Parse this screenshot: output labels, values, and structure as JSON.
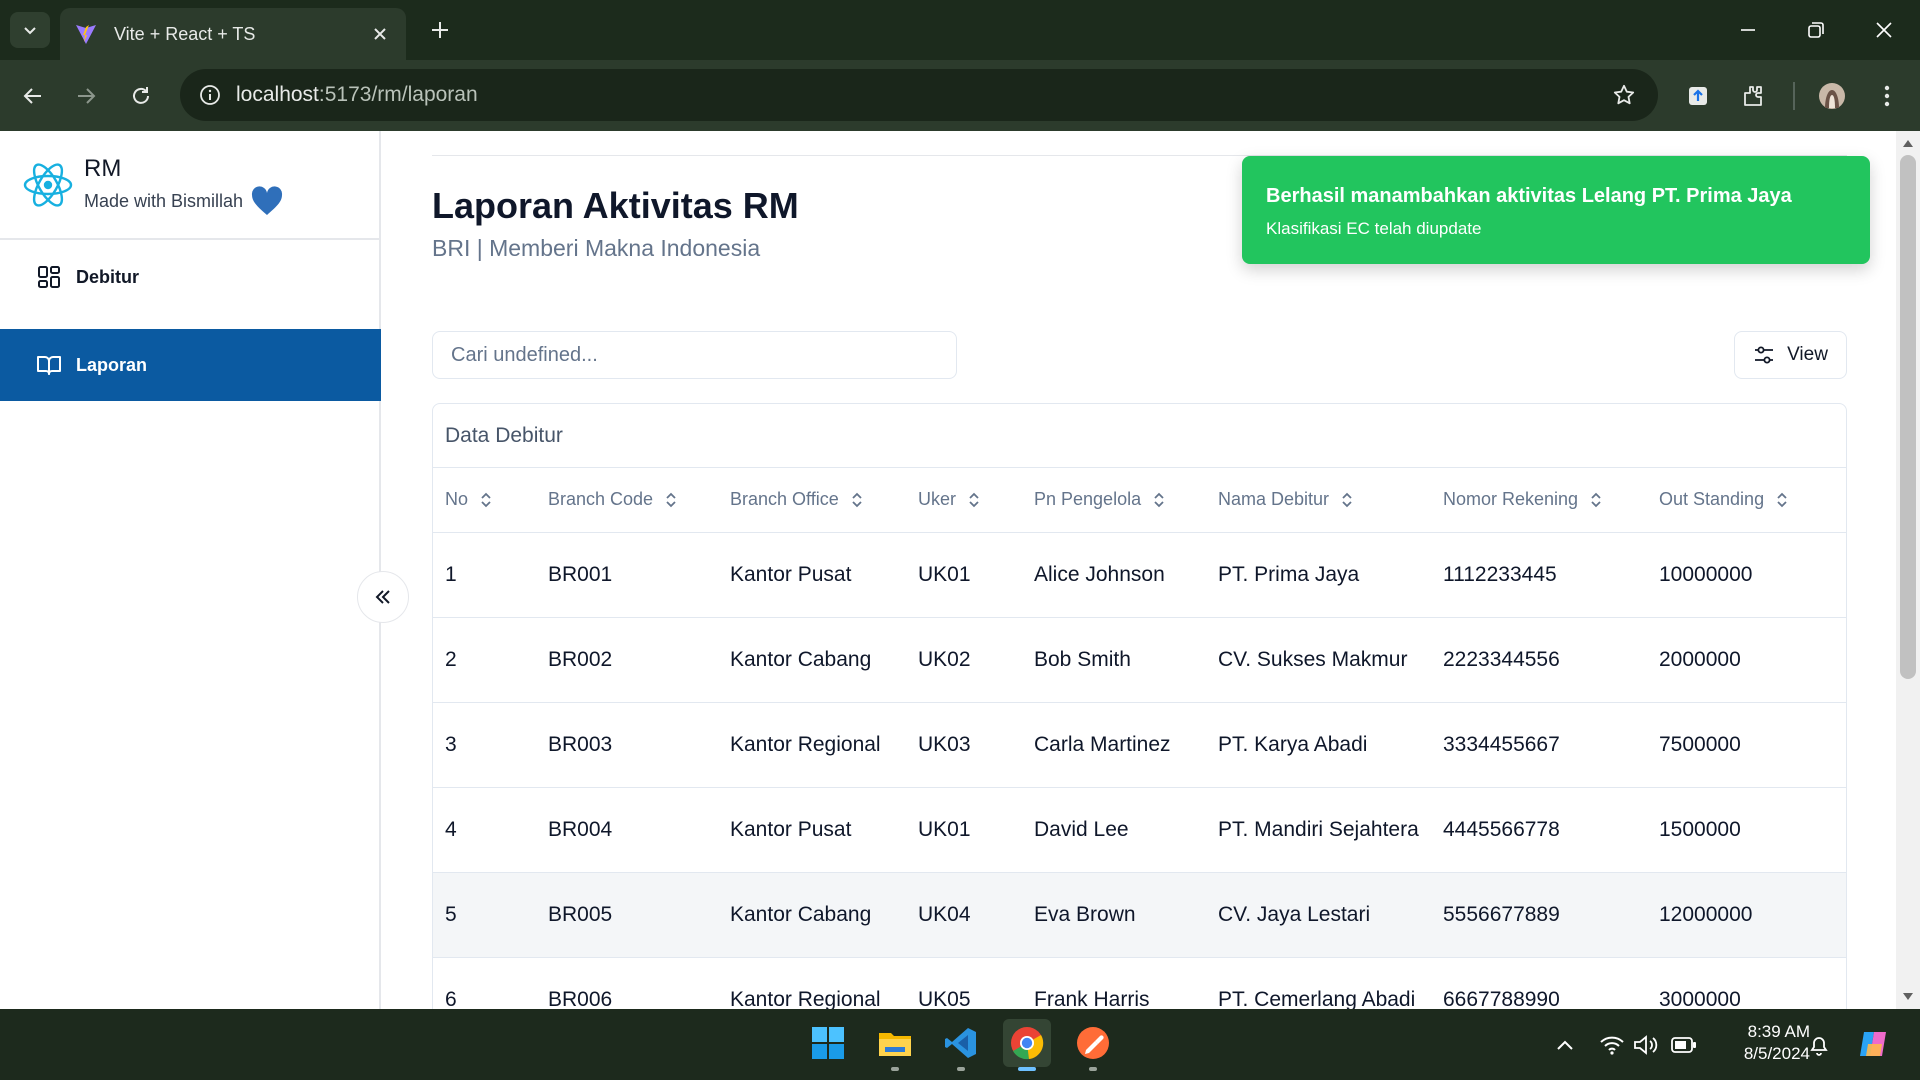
{
  "browser": {
    "tab_title": "Vite + React + TS",
    "url_host": "localhost",
    "url_rest": ":5173/rm/laporan"
  },
  "sidebar": {
    "app_name": "RM",
    "tagline": "Made with Bismillah",
    "items": [
      {
        "label": "Debitur",
        "icon": "dashboard-grid-icon",
        "active": false
      },
      {
        "label": "Laporan",
        "icon": "book-open-icon",
        "active": true
      }
    ]
  },
  "main": {
    "title": "Laporan Aktivitas RM",
    "subtitle": "BRI | Memberi Makna Indonesia",
    "search_placeholder": "Cari undefined...",
    "view_label": "View",
    "table": {
      "caption": "Data Debitur",
      "columns": [
        "No",
        "Branch Code",
        "Branch Office",
        "Uker",
        "Pn Pengelola",
        "Nama Debitur",
        "Nomor Rekening",
        "Out Standing"
      ],
      "rows": [
        [
          "1",
          "BR001",
          "Kantor Pusat",
          "UK01",
          "Alice Johnson",
          "PT. Prima Jaya",
          "1112233445",
          "10000000"
        ],
        [
          "2",
          "BR002",
          "Kantor Cabang",
          "UK02",
          "Bob Smith",
          "CV. Sukses Makmur",
          "2223344556",
          "2000000"
        ],
        [
          "3",
          "BR003",
          "Kantor Regional",
          "UK03",
          "Carla Martinez",
          "PT. Karya Abadi",
          "3334455667",
          "7500000"
        ],
        [
          "4",
          "BR004",
          "Kantor Pusat",
          "UK01",
          "David Lee",
          "PT. Mandiri Sejahtera",
          "4445566778",
          "1500000"
        ],
        [
          "5",
          "BR005",
          "Kantor Cabang",
          "UK04",
          "Eva Brown",
          "CV. Jaya Lestari",
          "5556677889",
          "12000000"
        ],
        [
          "6",
          "BR006",
          "Kantor Regional",
          "UK05",
          "Frank Harris",
          "PT. Cemerlang Abadi",
          "6667788990",
          "3000000"
        ]
      ]
    }
  },
  "toast": {
    "title": "Berhasil manambahkan aktivitas Lelang PT. Prima Jaya",
    "description": "Klasifikasi EC telah diupdate"
  },
  "taskbar": {
    "time": "8:39 AM",
    "date": "8/5/2024",
    "apps": [
      "windows-start-icon",
      "file-explorer-icon",
      "vscode-icon",
      "chrome-icon",
      "postman-icon"
    ]
  },
  "colors": {
    "accent": "#0b5aa1",
    "toast": "#22c55e",
    "chrome_frame": "#1c2b1c"
  }
}
